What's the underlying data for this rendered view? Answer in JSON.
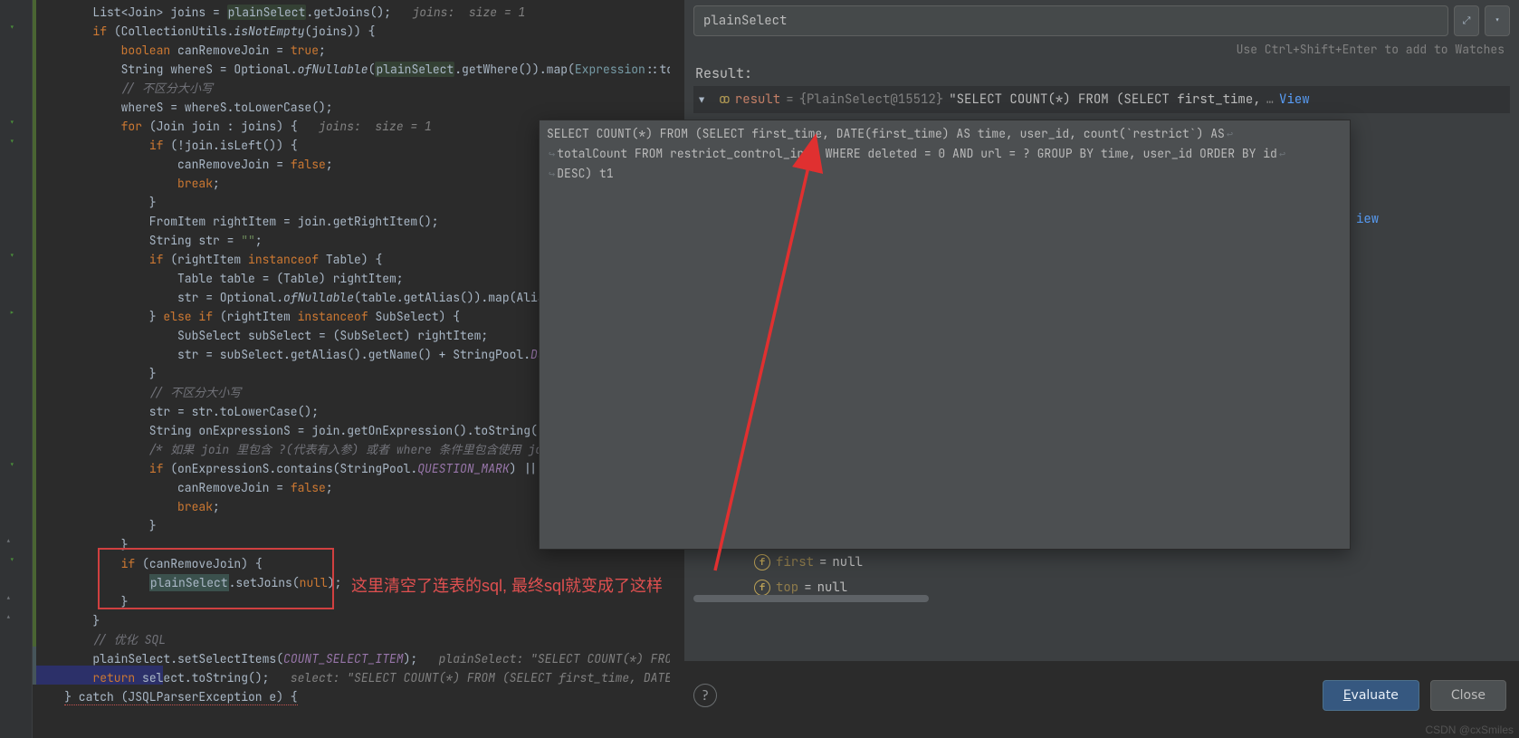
{
  "editor": {
    "inlay_joins": "joins:  size = 1",
    "inlay_joins2": "joins:  size = 1",
    "inlay_plainSelect": "plainSelect: \"SELECT COUNT(*) FROM (SELECT first",
    "inlay_select": "select: \"SELECT COUNT(*) FROM (SELECT first_time, DATE(first_time) AS time, user_id, count(`restrict`) AS totalCount FROM restrict_control_info WHERE deleted = 0 AND url = ? GROUP BY time, user_id",
    "red_note": "这里清空了连表的sql,  最终sql就变成了这样"
  },
  "debug": {
    "expr_placeholder": "plainSelect",
    "hint": "Use Ctrl+Shift+Enter to add to Watches",
    "result_label": "Result:",
    "result_name": "result",
    "result_type": "{PlainSelect@15512}",
    "result_value": "\"SELECT COUNT(*) FROM (SELECT first_time,",
    "view_link": "View",
    "popup_text": "SELECT COUNT(*) FROM (SELECT first_time, DATE(first_time) AS time, user_id, count(`restrict`) AS totalCount FROM restrict_control_info WHERE deleted = 0 AND url = ? GROUP BY time, user_id ORDER BY id DESC) t1",
    "var_first_name": "first",
    "var_first_value": "null",
    "var_top_name": "top",
    "var_top_value": "null",
    "view_partial": "iew",
    "help_label": "?",
    "evaluate_label": "Evaluate",
    "close_label": "Close",
    "watermark": "CSDN @cxSmiles"
  }
}
